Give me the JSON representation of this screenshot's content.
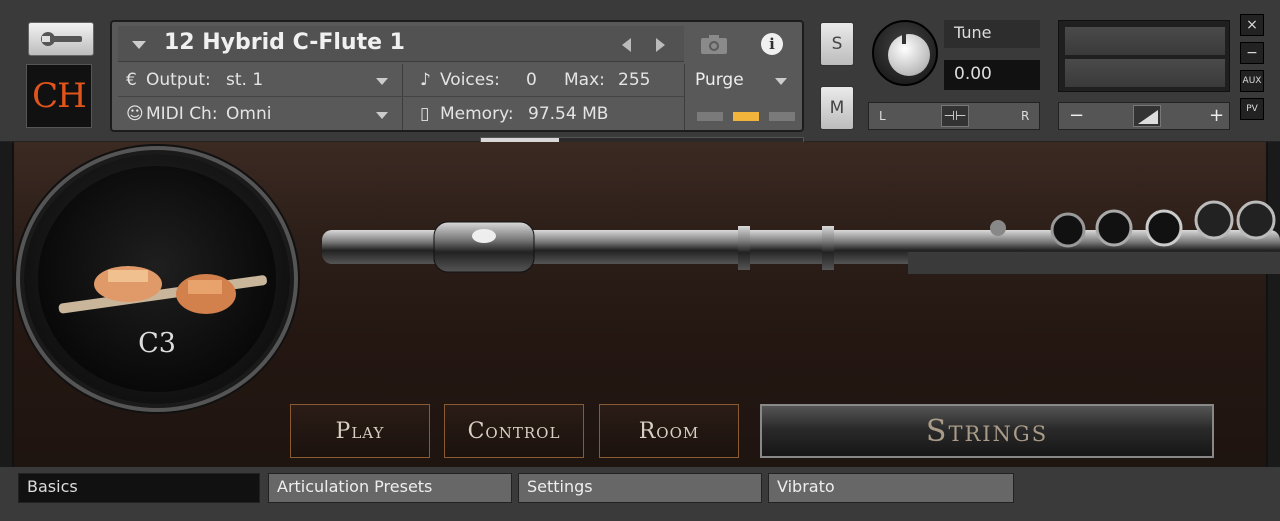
{
  "header": {
    "logo_text": "CH",
    "instrument_name": "12 Hybrid C-Flute 1",
    "output_label": "Output:",
    "output_value": "st. 1",
    "voices_label": "Voices:",
    "voices_value": "0",
    "max_label": "Max:",
    "max_value": "255",
    "midi_label": "MIDI Ch:",
    "midi_value": "Omni",
    "memory_label": "Memory:",
    "memory_value": "97.54 MB",
    "purge_label": "Purge",
    "solo_label": "S",
    "mute_label": "M",
    "tune_label": "Tune",
    "tune_value": "0.00",
    "pan_left": "L",
    "pan_right": "R",
    "vol_minus": "−",
    "vol_plus": "+",
    "close_label": "×",
    "minimize_label": "−",
    "aux_label": "AUX",
    "pv_label": "PV",
    "accent_color": "#e2541a",
    "purge_indicator_color": "#f2b43a"
  },
  "instrument": {
    "note_label": "C3",
    "buttons": {
      "play": "Play",
      "control": "Control",
      "room": "Room",
      "strings": "Strings"
    }
  },
  "tabs": [
    "Basics",
    "Articulation Presets",
    "Settings",
    "Vibrato"
  ],
  "active_tab": "Basics"
}
